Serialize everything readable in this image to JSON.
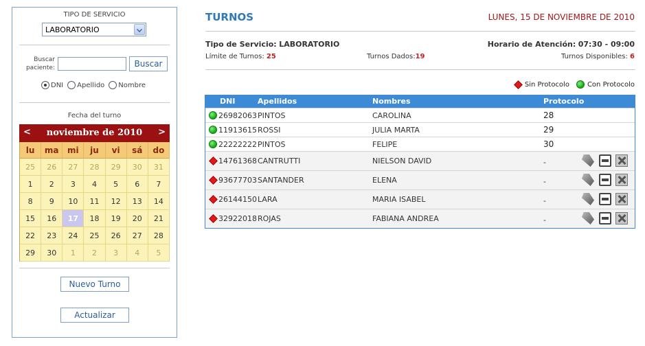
{
  "sidebar": {
    "service_label": "TIPO DE SERVICIO",
    "service_value": "LABORATORIO",
    "search_label_1": "Buscar",
    "search_label_2": "paciente:",
    "search_value": "",
    "search_button": "Buscar",
    "radio_options": [
      "DNI",
      "Apellido",
      "Nombre"
    ],
    "radio_selected": "DNI",
    "date_label": "Fecha del turno",
    "new_button": "Nuevo Turno",
    "refresh_button": "Actualizar"
  },
  "calendar": {
    "prev": "<",
    "next": ">",
    "title": "noviembre de 2010",
    "days_of_week": [
      "lu",
      "ma",
      "mi",
      "ju",
      "vi",
      "sá",
      "do"
    ],
    "weeks": [
      [
        {
          "d": "25",
          "other": true
        },
        {
          "d": "26",
          "other": true
        },
        {
          "d": "27",
          "other": true
        },
        {
          "d": "28",
          "other": true
        },
        {
          "d": "29",
          "other": true
        },
        {
          "d": "30",
          "other": true
        },
        {
          "d": "31",
          "other": true
        }
      ],
      [
        {
          "d": "1"
        },
        {
          "d": "2"
        },
        {
          "d": "3"
        },
        {
          "d": "4"
        },
        {
          "d": "5"
        },
        {
          "d": "6"
        },
        {
          "d": "7"
        }
      ],
      [
        {
          "d": "8"
        },
        {
          "d": "9"
        },
        {
          "d": "10"
        },
        {
          "d": "11"
        },
        {
          "d": "12"
        },
        {
          "d": "13"
        },
        {
          "d": "14"
        }
      ],
      [
        {
          "d": "15"
        },
        {
          "d": "16"
        },
        {
          "d": "17",
          "today": true
        },
        {
          "d": "18"
        },
        {
          "d": "19"
        },
        {
          "d": "20"
        },
        {
          "d": "21"
        }
      ],
      [
        {
          "d": "22"
        },
        {
          "d": "23"
        },
        {
          "d": "24"
        },
        {
          "d": "25"
        },
        {
          "d": "26"
        },
        {
          "d": "27"
        },
        {
          "d": "28"
        }
      ],
      [
        {
          "d": "29"
        },
        {
          "d": "30"
        },
        {
          "d": "1",
          "other": true
        },
        {
          "d": "2",
          "other": true
        },
        {
          "d": "3",
          "other": true
        },
        {
          "d": "4",
          "other": true
        },
        {
          "d": "5",
          "other": true
        }
      ]
    ]
  },
  "main": {
    "title": "TURNOS",
    "date": "LUNES, 15 DE NOVIEMBRE DE 2010",
    "service_type_label": "Tipo de Servicio:",
    "service_type_value": "LABORATORIO",
    "schedule_label": "Horario de Atención:",
    "schedule_value": "07:30 - 09:00",
    "limit_label": "Límite de Turnos:",
    "limit_value": "25",
    "given_label": "Turnos Dados:",
    "given_value": "19",
    "available_label": "Turnos Disponibles:",
    "available_value": "6",
    "legend_red": "Sin Protocolo",
    "legend_green": "Con Protocolo"
  },
  "table": {
    "columns": [
      "DNI",
      "Apellidos",
      "Nombres",
      "Protocolo"
    ],
    "rows": [
      {
        "status": "green",
        "dni": "26982063",
        "apellidos": "PINTOS",
        "nombres": "CAROLINA",
        "protocolo": "28"
      },
      {
        "status": "green",
        "dni": "11913615",
        "apellidos": "ROSSI",
        "nombres": "JULIA MARTA",
        "protocolo": "29"
      },
      {
        "status": "green",
        "dni": "22222222",
        "apellidos": "PINTOS",
        "nombres": "FELIPE",
        "protocolo": "30"
      },
      {
        "status": "red",
        "dni": "14761368",
        "apellidos": "CANTRUTTI",
        "nombres": "NIELSON DAVID",
        "protocolo": "-"
      },
      {
        "status": "red",
        "dni": "93677703",
        "apellidos": "SANTANDER",
        "nombres": "ELENA",
        "protocolo": "-"
      },
      {
        "status": "red",
        "dni": "26144150",
        "apellidos": "LARA",
        "nombres": "MARIA ISABEL",
        "protocolo": "-"
      },
      {
        "status": "red",
        "dni": "32922018",
        "apellidos": "ROJAS",
        "nombres": "FABIANA ANDREA",
        "protocolo": "-"
      }
    ]
  }
}
